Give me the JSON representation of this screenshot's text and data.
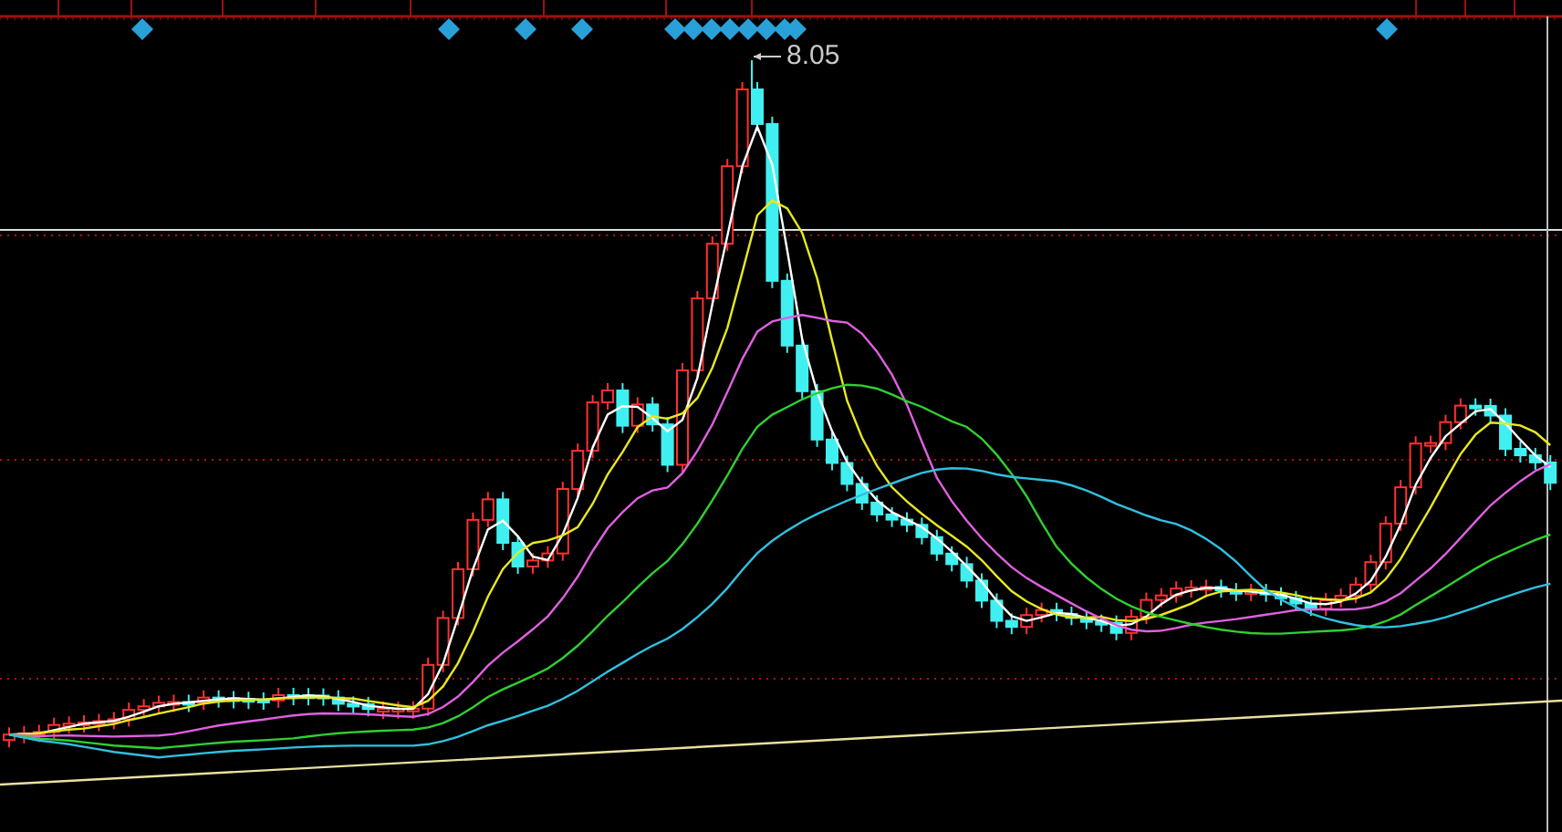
{
  "chart": {
    "high_label": "8.05"
  }
}
